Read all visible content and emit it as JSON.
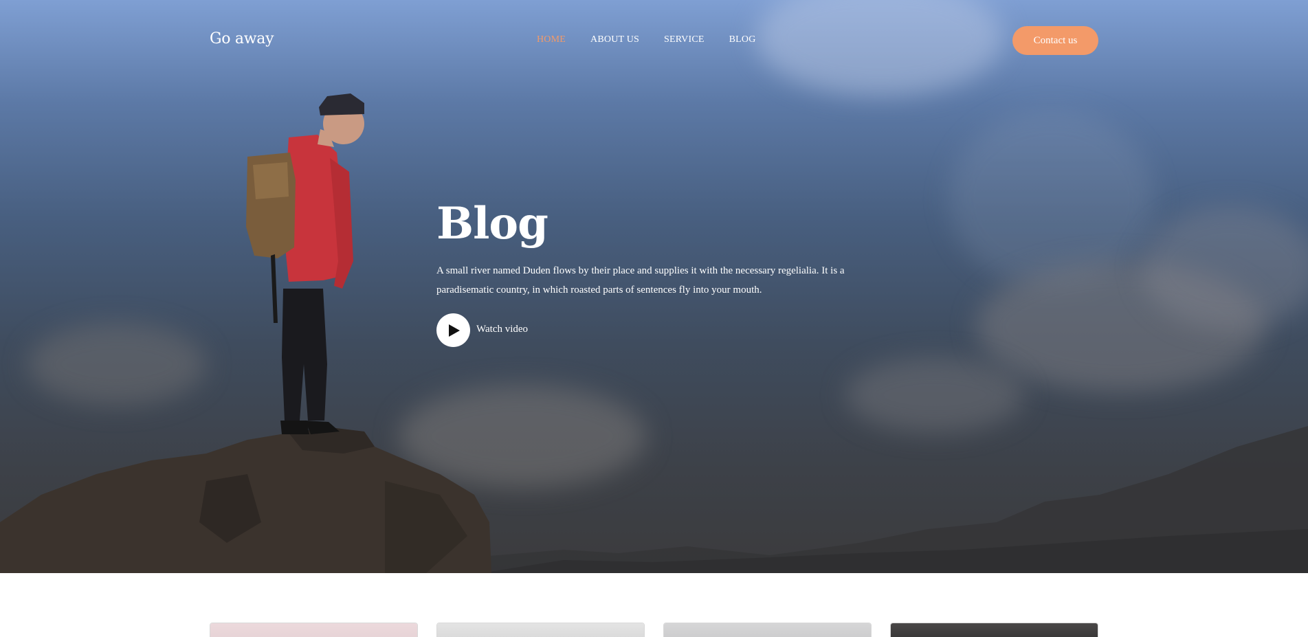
{
  "brand": {
    "name": "Go away"
  },
  "nav": {
    "items": [
      {
        "label": "HOME",
        "active": true
      },
      {
        "label": "ABOUT US",
        "active": false
      },
      {
        "label": "SERVICE",
        "active": false
      },
      {
        "label": "BLOG",
        "active": false
      }
    ],
    "contact_label": "Contact us"
  },
  "hero": {
    "title": "Blog",
    "text": "A small river named Duden flows by their place and supplies it with the necessary regelialia. It is a paradisematic country, in which roasted parts of sentences fly into your mouth.",
    "video_label": "Watch video",
    "play_icon": "play-icon"
  },
  "colors": {
    "accent": "#f39a69",
    "text_light": "#ffffff"
  },
  "cards": [
    {
      "thumb_color": "#ead6d9"
    },
    {
      "thumb_color": "#dcdcdc"
    },
    {
      "thumb_color": "#cfcfd0"
    },
    {
      "thumb_color": "#3b3a3a"
    }
  ]
}
